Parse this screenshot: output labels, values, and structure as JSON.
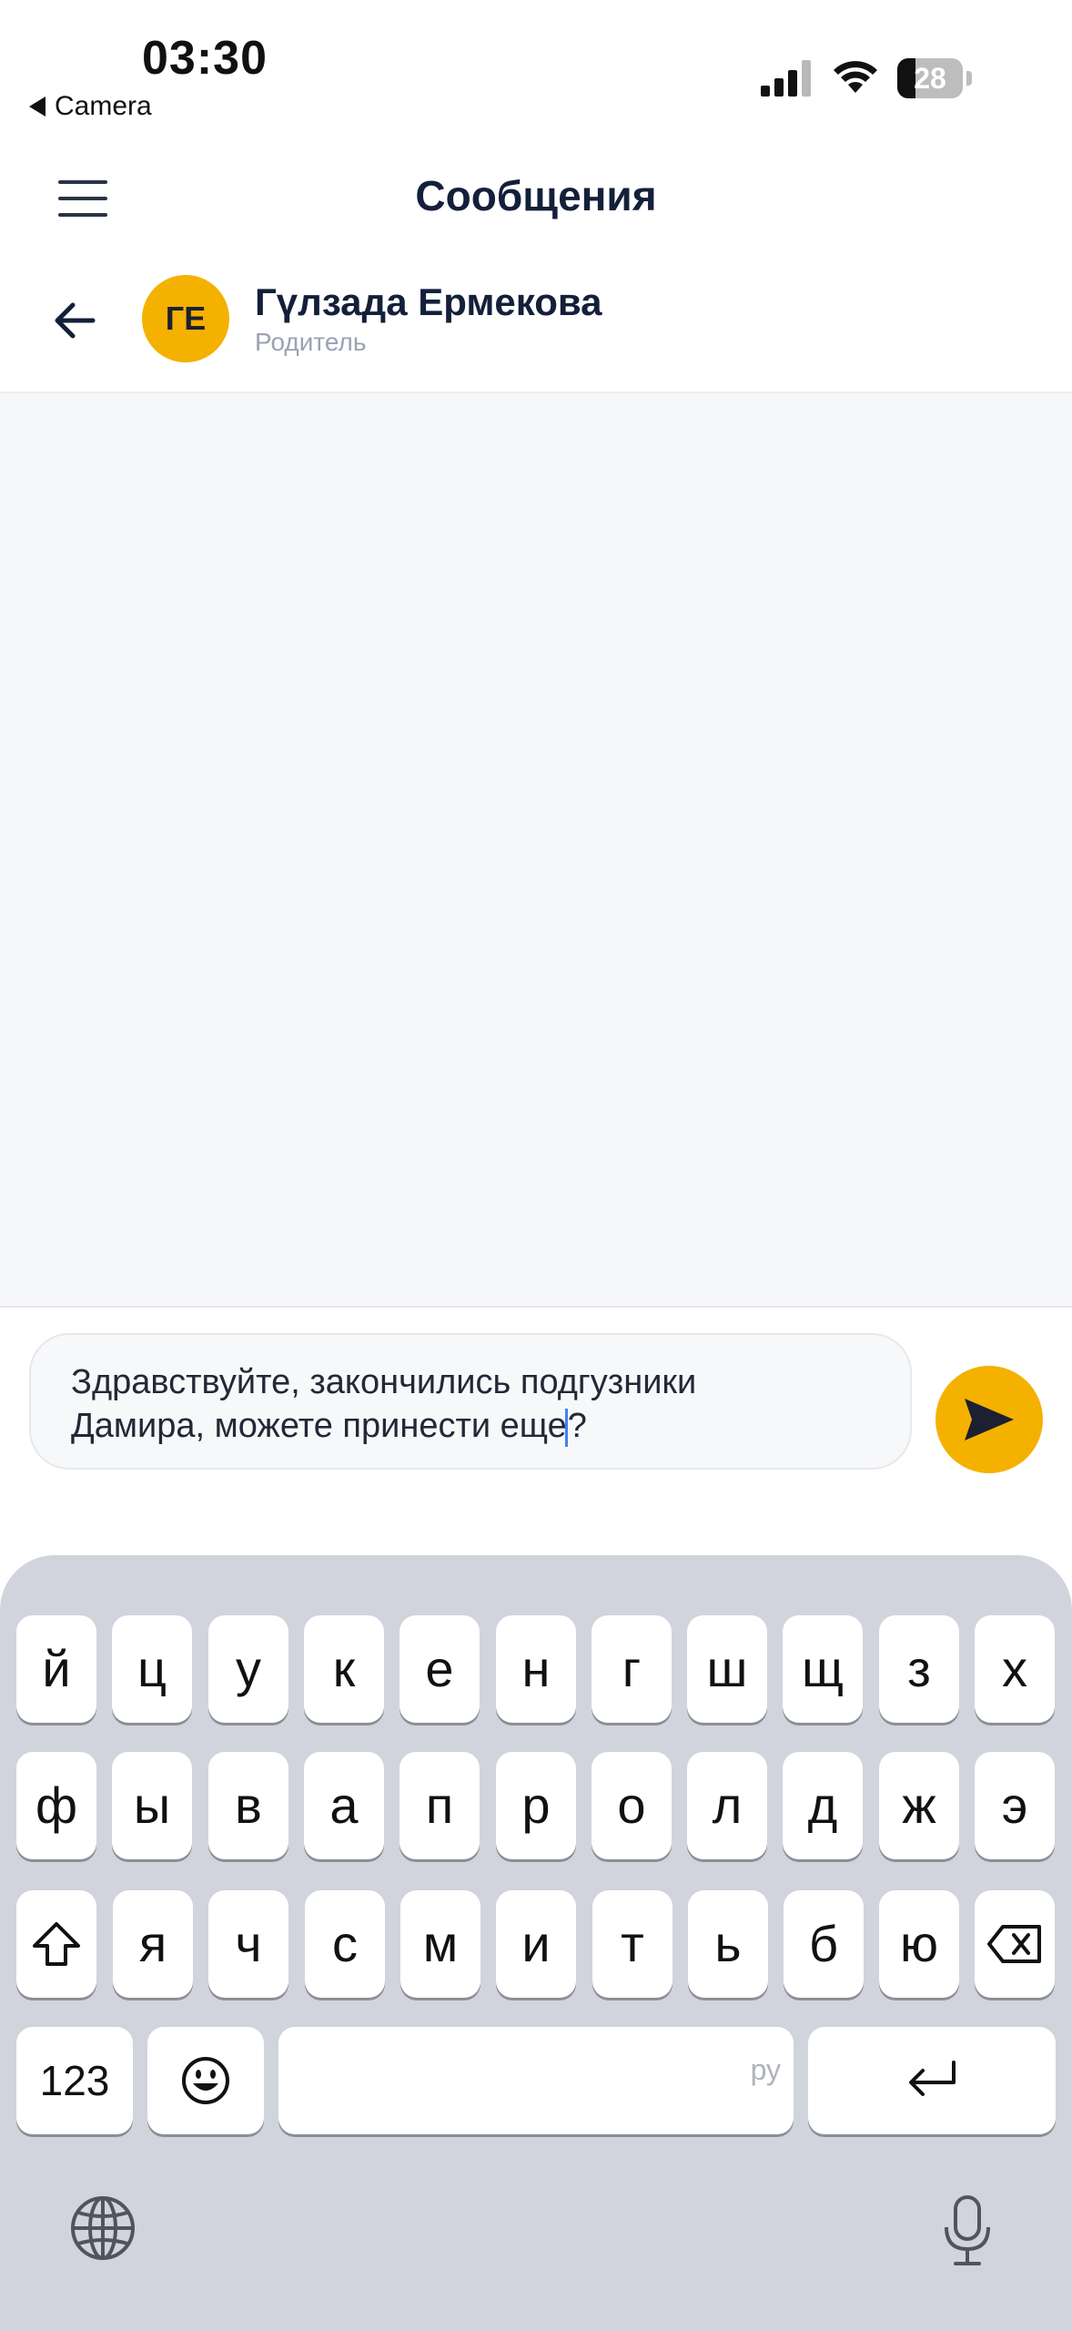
{
  "status_bar": {
    "time": "03:30",
    "back_app": "Camera",
    "battery_level": "28"
  },
  "header": {
    "title": "Сообщения"
  },
  "chat": {
    "avatar_initials": "ГЕ",
    "contact_name": "Гүлзада Ермекова",
    "contact_role": "Родитель"
  },
  "composer": {
    "message_line1": "Здравствуйте, закончились подгузники",
    "message_line2a": "Дамира, можете принести еще",
    "message_line2b": "?"
  },
  "keyboard": {
    "row1": [
      "й",
      "ц",
      "у",
      "к",
      "е",
      "н",
      "г",
      "ш",
      "щ",
      "з",
      "х"
    ],
    "row2": [
      "ф",
      "ы",
      "в",
      "а",
      "п",
      "р",
      "о",
      "л",
      "д",
      "ж",
      "э"
    ],
    "row3": [
      "я",
      "ч",
      "с",
      "м",
      "и",
      "т",
      "ь",
      "б",
      "ю"
    ],
    "numbers_key": "123",
    "space_language": "ру"
  },
  "icons": {
    "menu": "hamburger-menu-icon",
    "back": "arrow-left-icon",
    "send": "send-icon",
    "shift": "shift-icon",
    "delete": "backspace-icon",
    "emoji": "emoji-icon",
    "return": "return-icon",
    "globe": "globe-icon",
    "microphone": "microphone-icon"
  },
  "colors": {
    "accent": "#f4b100",
    "text_primary": "#14203a",
    "text_secondary": "#9aa3b2",
    "keyboard_bg": "#d1d4dc"
  }
}
